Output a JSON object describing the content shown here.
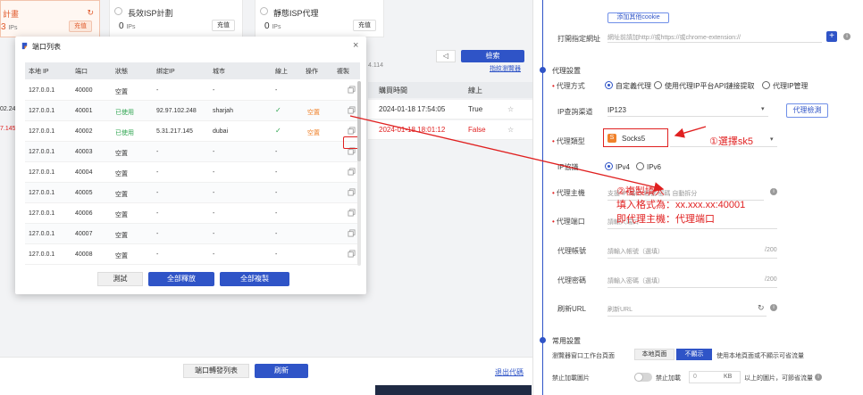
{
  "plans": [
    {
      "name": "計畫",
      "count": "3",
      "unit": "IPs",
      "recharge": "充值"
    },
    {
      "name": "長效ISP計劃",
      "count": "0",
      "unit": "IPs",
      "recharge": "充值"
    },
    {
      "name": "靜態ISP代理",
      "count": "0",
      "unit": "IPs",
      "recharge": "充值"
    }
  ],
  "background": {
    "search": "檢索",
    "filter_link": "指紋瀏覽器",
    "ip_fragment": "4.114",
    "table_headers": [
      "購買時間",
      "線上"
    ],
    "rows": [
      {
        "left": "02.24",
        "time": "2024-01-18 17:54:05",
        "online": "True",
        "left_color": "#333333",
        "color": "#333333"
      },
      {
        "left": "7.145",
        "time": "2024-01-18 18:01:12",
        "online": "False",
        "left_color": "#e02020",
        "color": "#e02020"
      }
    ],
    "port_forward_list": "端口轉發列表",
    "refresh": "刷新",
    "exit_code": "退出代碼"
  },
  "modal": {
    "title": "端口列表",
    "close": "×",
    "headers": [
      "本地 IP",
      "端口",
      "狀態",
      "綁定IP",
      "城市",
      "線上",
      "操作",
      "複製"
    ],
    "rows": [
      {
        "ip": "127.0.0.1",
        "port": "40000",
        "status": "空置",
        "bind": "-",
        "city": "-",
        "online": "-",
        "action": "",
        "used": false
      },
      {
        "ip": "127.0.0.1",
        "port": "40001",
        "status": "已使用",
        "bind": "92.97.102.248",
        "city": "sharjah",
        "online": "✓",
        "action": "空置",
        "used": true
      },
      {
        "ip": "127.0.0.1",
        "port": "40002",
        "status": "已使用",
        "bind": "5.31.217.145",
        "city": "dubai",
        "online": "✓",
        "action": "空置",
        "used": true
      },
      {
        "ip": "127.0.0.1",
        "port": "40003",
        "status": "空置",
        "bind": "-",
        "city": "-",
        "online": "-",
        "action": "",
        "used": false
      },
      {
        "ip": "127.0.0.1",
        "port": "40004",
        "status": "空置",
        "bind": "-",
        "city": "-",
        "online": "-",
        "action": "",
        "used": false
      },
      {
        "ip": "127.0.0.1",
        "port": "40005",
        "status": "空置",
        "bind": "-",
        "city": "-",
        "online": "-",
        "action": "",
        "used": false
      },
      {
        "ip": "127.0.0.1",
        "port": "40006",
        "status": "空置",
        "bind": "-",
        "city": "-",
        "online": "-",
        "action": "",
        "used": false
      },
      {
        "ip": "127.0.0.1",
        "port": "40007",
        "status": "空置",
        "bind": "-",
        "city": "-",
        "online": "-",
        "action": "",
        "used": false
      },
      {
        "ip": "127.0.0.1",
        "port": "40008",
        "status": "空置",
        "bind": "-",
        "city": "-",
        "online": "-",
        "action": "",
        "used": false
      }
    ],
    "btn_test": "測試",
    "btn_release_all": "全部釋放",
    "btn_copy_all": "全部複製"
  },
  "right": {
    "add_cookie": "添加其他cookie",
    "open_url_label": "打開指定網址",
    "open_url_placeholder": "網址前請加http://或https://或chrome-extension://",
    "proxy_section": "代理設置",
    "proxy_mode_label": "代理方式",
    "proxy_modes": [
      "自定義代理",
      "使用代理IP平台API鏈接提取",
      "代理IP管理"
    ],
    "ip_query_label": "IP查詢渠道",
    "ip_query_value": "IP123",
    "proxy_check": "代理檢測",
    "proxy_type_label": "代理類型",
    "proxy_type_value": "Socks5",
    "ip_protocol_label": "IP協議",
    "ip_protocols": [
      "IPv4",
      "IPv6"
    ],
    "proxy_host_label": "代理主機",
    "proxy_host_placeholder": "支援 IP:端口:帳號:密碼 自動拆分",
    "proxy_port_label": "代理端口",
    "proxy_port_placeholder": "請輸入端口",
    "proxy_account_label": "代理帳號",
    "proxy_account_placeholder": "請輸入帳號（選填）",
    "proxy_password_label": "代理密碼",
    "proxy_password_placeholder": "請輸入密碼（選填）",
    "char_limit": "/200",
    "refresh_url_label": "刷新URL",
    "refresh_url_placeholder": "刷新URL",
    "common_section": "常用設置",
    "browser_tab_label": "瀏覽器窗口工作台頁面",
    "browser_tab_options": [
      "本地頁面",
      "不顯示"
    ],
    "browser_tab_desc": "使用本地頁面或不顯示可省流量",
    "image_block_label": "禁止加載圖片",
    "image_block_toggle_label": "禁止加載",
    "kb_value": "0",
    "kb_unit": "KB",
    "image_desc": "以上的圖片，可節省流量"
  },
  "annotations": {
    "select_sk5": "①選擇sk5",
    "copy_fill": "②複製填入",
    "fill_format": "填入格式為：xx.xxx.xx:40001",
    "host_port": "即代理主機：代理端口"
  },
  "colors": {
    "accent": "#2f54c7",
    "annotation": "#e02020",
    "success": "#2ea44f",
    "warning": "#f0822b"
  }
}
